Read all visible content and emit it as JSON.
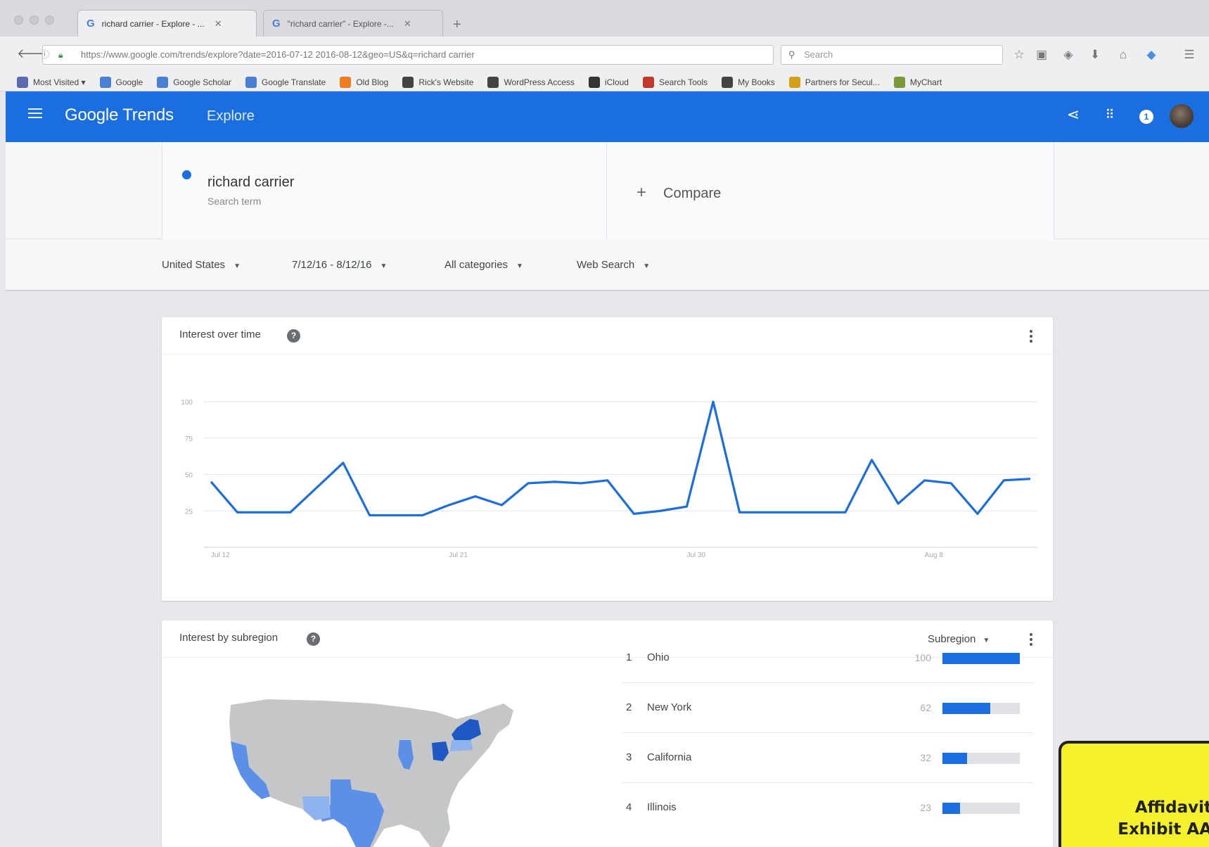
{
  "browser": {
    "tabs": [
      {
        "label": "richard carrier - Explore - ...",
        "active": true
      },
      {
        "label": "\"richard carrier\" - Explore -...",
        "active": false
      }
    ],
    "url": "https://www.google.com/trends/explore?date=2016-07-12 2016-08-12&geo=US&q=richard carrier",
    "search_placeholder": "Search",
    "bookmarks": [
      {
        "label": "Most Visited ▾",
        "icon": "folder-icon",
        "color": "#5b6ab0"
      },
      {
        "label": "Google",
        "icon": "google-icon",
        "color": "#4a7fd6"
      },
      {
        "label": "Google Scholar",
        "icon": "scholar-icon",
        "color": "#4a7fd6"
      },
      {
        "label": "Google Translate",
        "icon": "translate-icon",
        "color": "#4a7fd6"
      },
      {
        "label": "Old Blog",
        "icon": "blogger-icon",
        "color": "#f07c22"
      },
      {
        "label": "Rick's Website",
        "icon": "site-icon",
        "color": "#444444"
      },
      {
        "label": "WordPress Access",
        "icon": "site-icon",
        "color": "#444444"
      },
      {
        "label": "iCloud",
        "icon": "apple-icon",
        "color": "#333333"
      },
      {
        "label": "Search Tools",
        "icon": "tools-icon",
        "color": "#c0392b"
      },
      {
        "label": "My Books",
        "icon": "books-icon",
        "color": "#444444"
      },
      {
        "label": "Partners for Secul...",
        "icon": "partners-icon",
        "color": "#d4a017"
      },
      {
        "label": "MyChart",
        "icon": "mychart-icon",
        "color": "#7a9a3a"
      }
    ]
  },
  "header": {
    "logo": "Google Trends",
    "section": "Explore",
    "notification_count": "1",
    "color": "#1a6ee0"
  },
  "search": {
    "term": "richard carrier",
    "term_type": "Search term",
    "compare_label": "Compare"
  },
  "filters": {
    "region": "United States",
    "date_range": "7/12/16 - 8/12/16",
    "category": "All categories",
    "property": "Web Search"
  },
  "interest_over_time": {
    "title": "Interest over time"
  },
  "chart_data": {
    "type": "line",
    "x": [
      "2016-07-12",
      "2016-07-13",
      "2016-07-14",
      "2016-07-15",
      "2016-07-16",
      "2016-07-17",
      "2016-07-18",
      "2016-07-19",
      "2016-07-20",
      "2016-07-21",
      "2016-07-22",
      "2016-07-23",
      "2016-07-24",
      "2016-07-25",
      "2016-07-26",
      "2016-07-27",
      "2016-07-28",
      "2016-07-29",
      "2016-07-30",
      "2016-07-31",
      "2016-08-01",
      "2016-08-02",
      "2016-08-03",
      "2016-08-04",
      "2016-08-05",
      "2016-08-06",
      "2016-08-07",
      "2016-08-08",
      "2016-08-09",
      "2016-08-10",
      "2016-08-11",
      "2016-08-12"
    ],
    "series": [
      {
        "values": [
          45,
          24,
          24,
          24,
          41,
          58,
          22,
          22,
          22,
          29,
          35,
          29,
          44,
          45,
          44,
          46,
          23,
          25,
          28,
          100,
          24,
          24,
          24,
          24,
          24,
          60,
          30,
          46,
          44,
          23,
          46,
          47
        ],
        "color": "#1a6ee0"
      }
    ],
    "x_tick_labels": [
      "Jul 12",
      "Jul 21",
      "Jul 30",
      "Aug 8"
    ],
    "y_tick_labels": [
      "100",
      "75",
      "50",
      "25"
    ],
    "ylim": [
      0,
      100
    ],
    "grid": true
  },
  "interest_by_subregion": {
    "title": "Interest by subregion",
    "selector": "Subregion",
    "rows": [
      {
        "rank": "1",
        "name": "Ohio",
        "value": "100",
        "fraction": 1.0
      },
      {
        "rank": "2",
        "name": "New York",
        "value": "62",
        "fraction": 0.62
      },
      {
        "rank": "3",
        "name": "California",
        "value": "32",
        "fraction": 0.32
      },
      {
        "rank": "4",
        "name": "Illinois",
        "value": "23",
        "fraction": 0.23
      }
    ]
  },
  "sticker": {
    "text": "Affidavit\nExhibit AA",
    "color": "#f5f02c"
  }
}
